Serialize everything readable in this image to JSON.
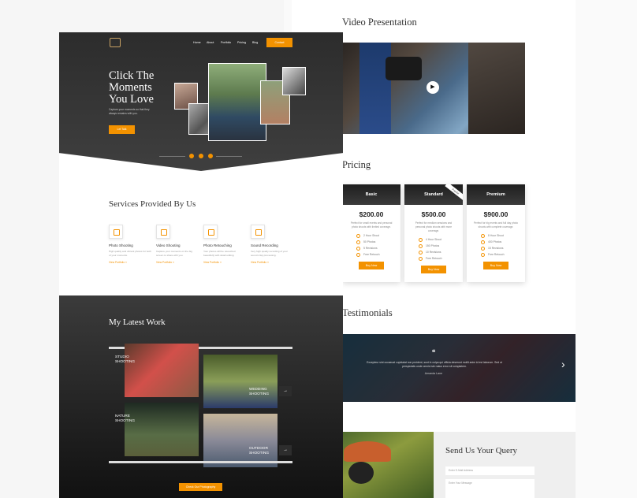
{
  "right_page": {
    "video_heading": "Video Presentation",
    "pricing_heading": "Pricing",
    "plans": [
      {
        "name": "Basic",
        "price": "$200.00",
        "description": "Perfect for small events and personal photo shoots with limited coverage.",
        "features": [
          "2 Hour Shoot",
          "50 Photos",
          "5 Revisions",
          "Free Retouch"
        ],
        "button": "Buy Now"
      },
      {
        "name": "Standard",
        "price": "$500.00",
        "description": "Perfect for medium sessions and personal photo shoots with more coverage.",
        "features": [
          "4 Hour Shoot",
          "150 Photos",
          "10 Revisions",
          "Free Retouch"
        ],
        "button": "Buy Now",
        "badge": "Popular"
      },
      {
        "name": "Premium",
        "price": "$900.00",
        "description": "Perfect for big events and full day photo shoots with complete coverage.",
        "features": [
          "8 Hour Shoot",
          "400 Photos",
          "15 Revisions",
          "Free Retouch"
        ],
        "button": "Buy Now"
      }
    ],
    "testimonials_heading": "Testimonials",
    "testimonial_quote_mark": "❝",
    "testimonial_text": "Excepteur sint occaecat cupidatat non proident, sunt in culpa qui officia deserunt mollit anim id est laborum. Sed ut perspiciatis unde omnis iste natus error sit voluptatem.",
    "testimonial_author": "Amanda Lane",
    "query_heading": "Send Us Your Query",
    "email_placeholder": "Enter E-Mail Address",
    "message_placeholder": "Enter Your Message"
  },
  "left_page": {
    "nav": [
      "Home",
      "About",
      "Portfolio",
      "Pricing",
      "Blog"
    ],
    "nav_button": "Contact",
    "hero_title": "Click The Moments You Love",
    "hero_subtitle": "Capture your moments so that they always remains with you.",
    "hero_button": "Let Talk",
    "services_heading": "Services Provided By Us",
    "services": [
      {
        "title": "Photo Shooting",
        "desc": "High quality and vibrant photos for both of your moments.",
        "more": "View Portfolio »"
      },
      {
        "title": "Video Shooting",
        "desc": "Capture your moments on the big screen to share with you.",
        "more": "View Portfolio »"
      },
      {
        "title": "Photo Retouching",
        "desc": "Your photos will be retouched beautifully with detail editing.",
        "more": "View Portfolio »"
      },
      {
        "title": "Sound Recording",
        "desc": "Very high quality recording of your sound crisp processing.",
        "more": "View Portfolio »"
      }
    ],
    "work_heading": "My Latest Work",
    "work_items": [
      "Studio Shooting",
      "Wedding Shooting",
      "Nature Shooting",
      "Outdoor Shooting"
    ],
    "work_button": "Check Our Photography"
  },
  "colors": {
    "accent": "#f39200",
    "dark": "#2c2c2c"
  }
}
